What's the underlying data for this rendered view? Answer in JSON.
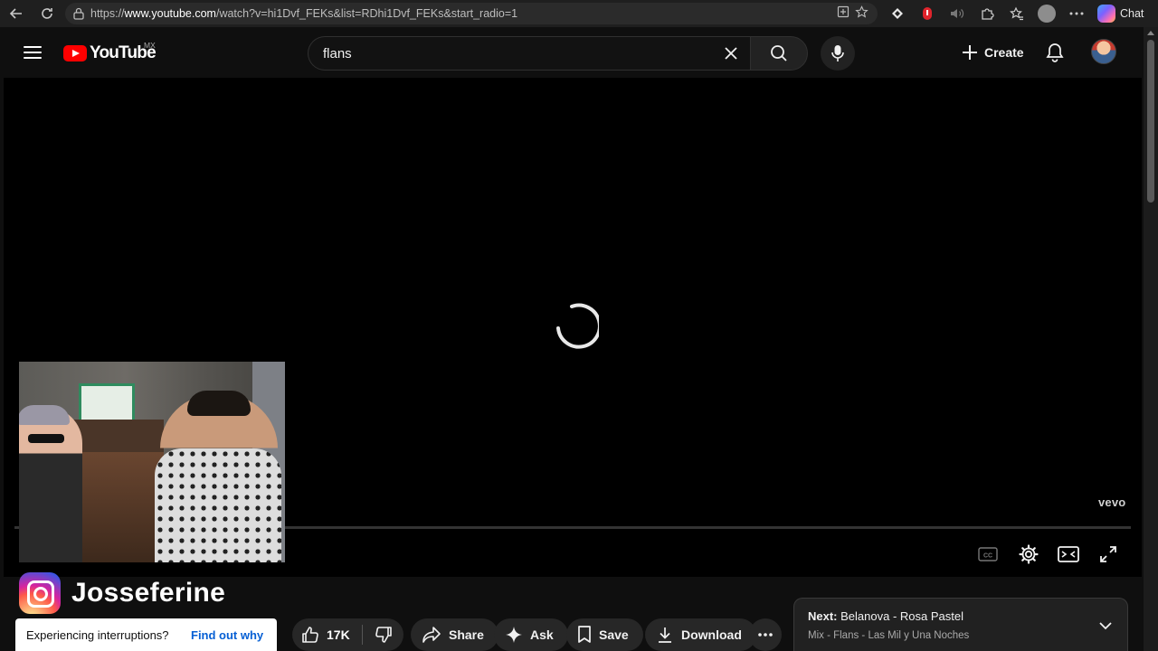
{
  "browser": {
    "url_prefix": "https://",
    "url_host": "www.youtube.com",
    "url_path": "/watch?v=hi1Dvf_FEKs&list=RDhi1Dvf_FEKs&start_radio=1",
    "chat_label": "Chat"
  },
  "masthead": {
    "logo_text": "YouTube",
    "region": "MX",
    "search_value": "flans",
    "create_label": "Create"
  },
  "player": {
    "watermark": "vevo",
    "state": "loading",
    "progress_fraction": 0
  },
  "overlay": {
    "instagram_handle": "Josseferine"
  },
  "interruption": {
    "message": "Experiencing interruptions?",
    "link": "Find out why"
  },
  "actions": {
    "likes": "17K",
    "share": "Share",
    "ask": "Ask",
    "save": "Save",
    "download": "Download"
  },
  "up_next": {
    "prefix": "Next:",
    "title": "Belanova - Rosa Pastel",
    "subtitle": "Mix - Flans - Las Mil y Una Noches"
  },
  "colors": {
    "brand_red": "#ff0000",
    "link_blue": "#065fd4",
    "background": "#0f0f0f"
  }
}
